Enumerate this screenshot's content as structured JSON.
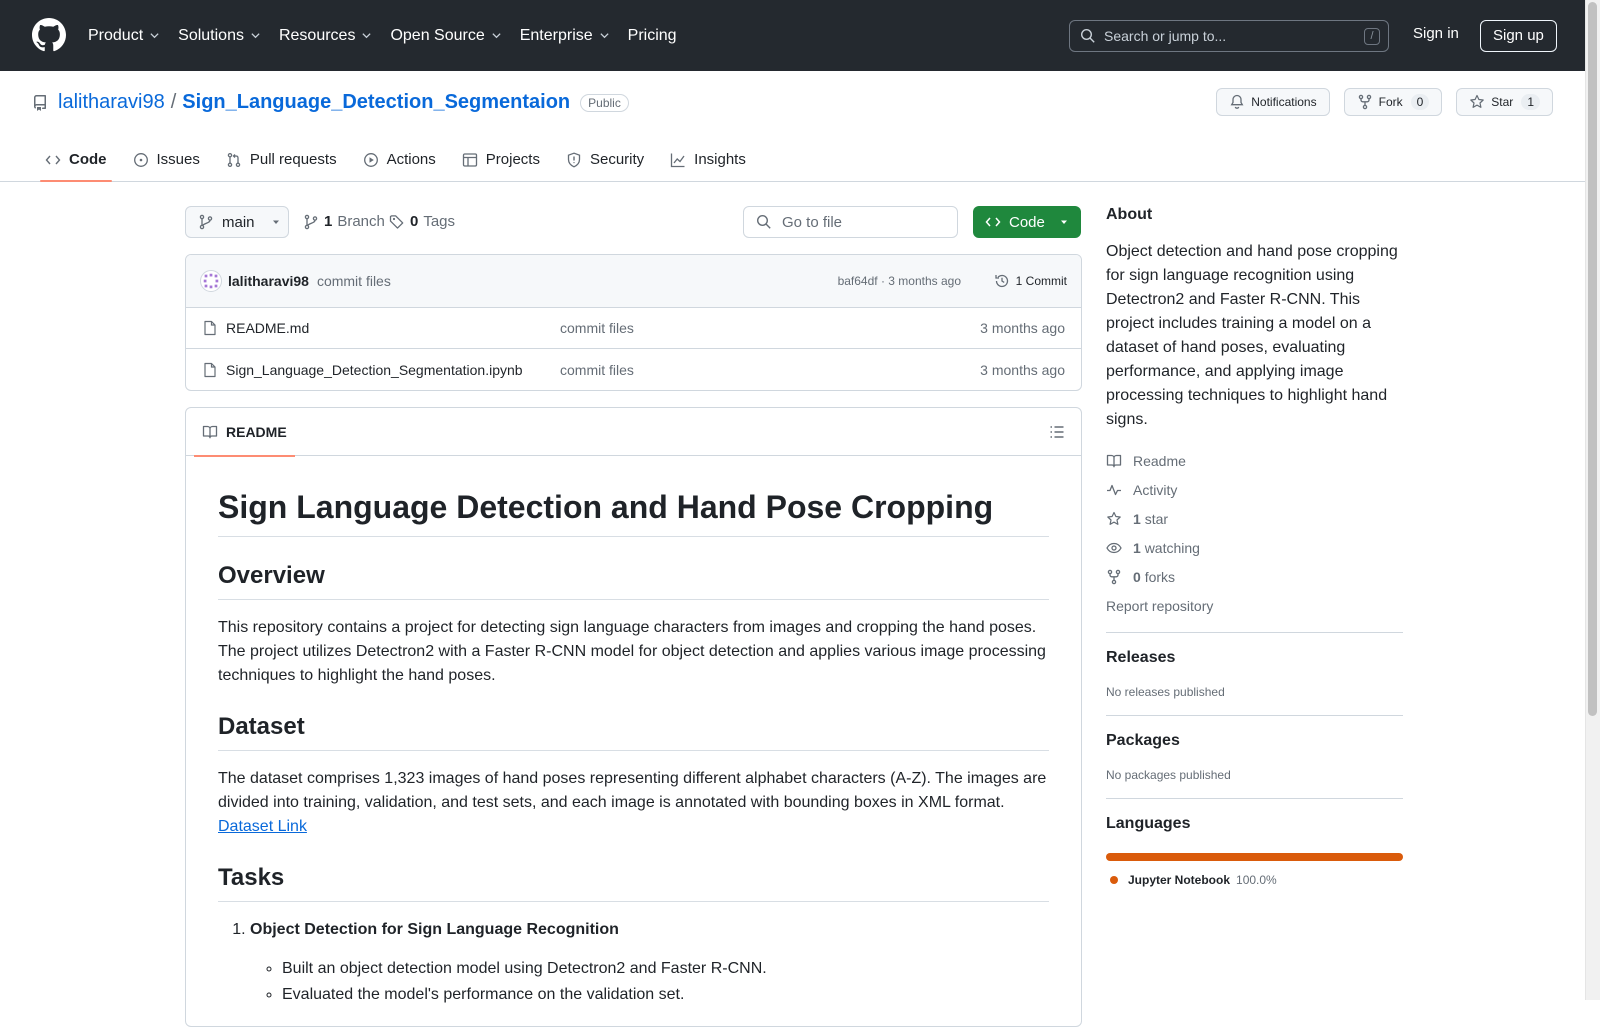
{
  "header": {
    "nav": [
      "Product",
      "Solutions",
      "Resources",
      "Open Source",
      "Enterprise",
      "Pricing"
    ],
    "search_placeholder": "Search or jump to...",
    "search_shortcut": "/",
    "sign_in": "Sign in",
    "sign_up": "Sign up"
  },
  "repo": {
    "owner": "lalitharavi98",
    "separator": "/",
    "name": "Sign_Language_Detection_Segmentaion",
    "visibility": "Public",
    "notifications_label": "Notifications",
    "fork_label": "Fork",
    "fork_count": "0",
    "star_label": "Star",
    "star_count": "1"
  },
  "tabs": [
    "Code",
    "Issues",
    "Pull requests",
    "Actions",
    "Projects",
    "Security",
    "Insights"
  ],
  "toolbar": {
    "branch": "main",
    "branch_count": "1",
    "branch_label": "Branch",
    "tag_count": "0",
    "tag_label": "Tags",
    "goto_placeholder": "Go to file",
    "code_label": "Code"
  },
  "commit": {
    "author": "lalitharavi98",
    "message": "commit files",
    "meta": "baf64df · 3 months ago",
    "count_label": "1 Commit"
  },
  "files": [
    {
      "name": "README.md",
      "message": "commit files",
      "time": "3 months ago"
    },
    {
      "name": "Sign_Language_Detection_Segmentation.ipynb",
      "message": "commit files",
      "time": "3 months ago"
    }
  ],
  "readme": {
    "tab_label": "README",
    "title": "Sign Language Detection and Hand Pose Cropping",
    "overview_heading": "Overview",
    "overview_text": "This repository contains a project for detecting sign language characters from images and cropping the hand poses. The project utilizes Detectron2 with a Faster R-CNN model for object detection and applies various image processing techniques to highlight the hand poses.",
    "dataset_heading": "Dataset",
    "dataset_text": "The dataset comprises 1,323 images of hand poses representing different alphabet characters (A-Z). The images are divided into training, validation, and test sets, and each image is annotated with bounding boxes in XML format.",
    "dataset_link": "Dataset Link",
    "tasks_heading": "Tasks",
    "task1": "Object Detection for Sign Language Recognition",
    "task1_bullets": [
      "Built an object detection model using Detectron2 and Faster R-CNN.",
      "Evaluated the model's performance on the validation set."
    ]
  },
  "sidebar": {
    "about_heading": "About",
    "about_text": "Object detection and hand pose cropping for sign language recognition using Detectron2 and Faster R-CNN. This project includes training a model on a dataset of hand poses, evaluating performance, and applying image processing techniques to highlight hand signs.",
    "readme": "Readme",
    "activity": "Activity",
    "stars_count": "1",
    "stars_label": "star",
    "watching_count": "1",
    "watching_label": "watching",
    "forks_count": "0",
    "forks_label": "forks",
    "report": "Report repository",
    "releases_heading": "Releases",
    "releases_sub": "No releases published",
    "packages_heading": "Packages",
    "packages_sub": "No packages published",
    "languages_heading": "Languages",
    "language_name": "Jupyter Notebook",
    "language_pct": "100.0%",
    "language_fraction": 1.0,
    "language_color": "#DA5B0B"
  },
  "colors": {
    "header_bg": "#24292f",
    "link": "#0969da",
    "code_button": "#1f883d",
    "tab_underline": "#fd8c73"
  }
}
